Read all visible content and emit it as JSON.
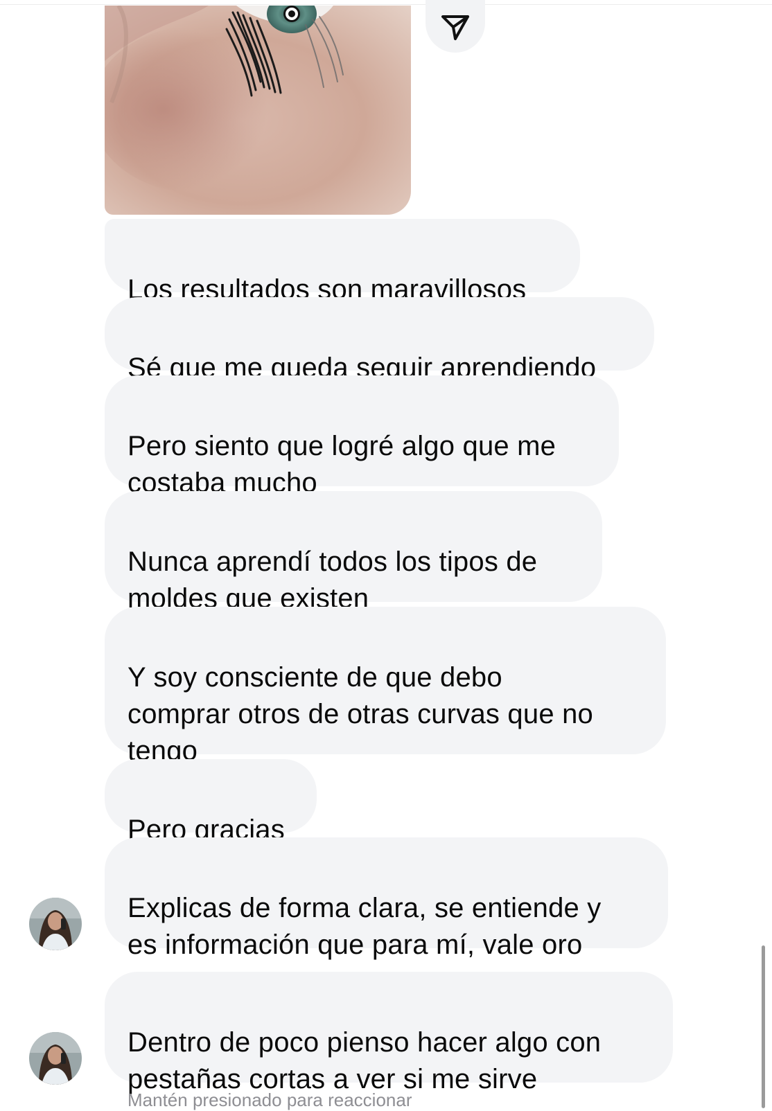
{
  "chat": {
    "shared_image": {
      "kind": "photo",
      "subject": "eye-with-lash-lift"
    },
    "share_icon": "send-paper-plane-icon",
    "messages": [
      {
        "text": "Los resultados son maravillosos"
      },
      {
        "text": "Sé que me queda seguir aprendiendo"
      },
      {
        "text": "Pero siento que logré algo que me\ncostaba mucho"
      },
      {
        "text": "Nunca aprendí todos los tipos de\nmoldes que existen"
      },
      {
        "text": "Y soy consciente de que debo\ncomprar otros de otras curvas que no\ntengo"
      },
      {
        "text": "Pero gracias"
      },
      {
        "text": "Explicas de forma clara, se entiende y\nes información que para mí, vale oro"
      },
      {
        "text": "Dentro de poco pienso hacer algo con\npestañas cortas a ver si me sirve"
      }
    ],
    "reaction_hint": "Mantén presionado para reaccionar"
  },
  "colors": {
    "bubble_bg": "#f3f4f6",
    "text": "#0a0a0a",
    "hint": "#8e8e93"
  }
}
